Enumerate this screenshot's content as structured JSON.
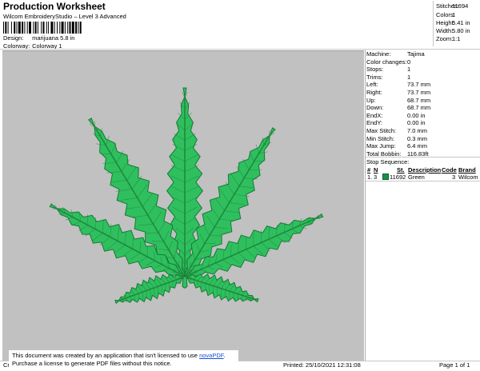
{
  "header": {
    "title": "Production Worksheet",
    "subtitle": "Wilcom EmbroideryStudio – Level 3 Advanced"
  },
  "design": {
    "design_label": "Design:",
    "design_value": "marijuana 5.8  in",
    "colorway_label": "Colorway:",
    "colorway_value": "Colorway 1"
  },
  "stats": [
    {
      "label": "Stitches:",
      "value": "11694"
    },
    {
      "label": "Colors:",
      "value": "1"
    },
    {
      "label": "Height:",
      "value": "5.41 in"
    },
    {
      "label": "Width:",
      "value": "5.80 in"
    },
    {
      "label": "Zoom:",
      "value": "1:1"
    }
  ],
  "machine_info": [
    {
      "label": "Machine:",
      "value": "Tajima"
    },
    {
      "label": "Color changes:",
      "value": "0"
    },
    {
      "label": "Stops:",
      "value": "1"
    },
    {
      "label": "Trims:",
      "value": "1"
    },
    {
      "label": "Left:",
      "value": "73.7 mm"
    },
    {
      "label": "Right:",
      "value": "73.7 mm"
    },
    {
      "label": "Up:",
      "value": "68.7 mm"
    },
    {
      "label": "Down:",
      "value": "68.7 mm"
    },
    {
      "label": "EndX:",
      "value": "0.00 in"
    },
    {
      "label": "EndY:",
      "value": "0.00 in"
    },
    {
      "label": "Max Stitch:",
      "value": "7.0 mm"
    },
    {
      "label": "Min Stitch:",
      "value": "0.3 mm"
    },
    {
      "label": "Max Jump:",
      "value": "6.4 mm"
    },
    {
      "label": "Total Bobbin:",
      "value": "116.83ft"
    }
  ],
  "stop_sequence": {
    "title": "Stop Sequence:",
    "headers": {
      "num": "#",
      "n": "N",
      "st": "St.",
      "description": "Description",
      "code": "Code",
      "brand": "Brand"
    },
    "rows": [
      {
        "num": "1.",
        "n": "3",
        "st": "11692",
        "description": "Green",
        "code": "3",
        "brand": "Wilcom",
        "color": "#1a8f4a"
      }
    ]
  },
  "leaf_colors": {
    "fill": "#2fbf5f",
    "vein": "#1f8a3d",
    "outline": "#167a33"
  },
  "notice": {
    "line1_prefix": "This document was created by an application that isn't licensed to use ",
    "link": "novaPDF",
    "line1_suffix": ".",
    "line2": "Purchase a license to generate PDF files without this notice."
  },
  "footer": {
    "left": "Cr",
    "printed": "Printed: 25/10/2021 12:31:08",
    "page": "Page 1 of 1"
  }
}
